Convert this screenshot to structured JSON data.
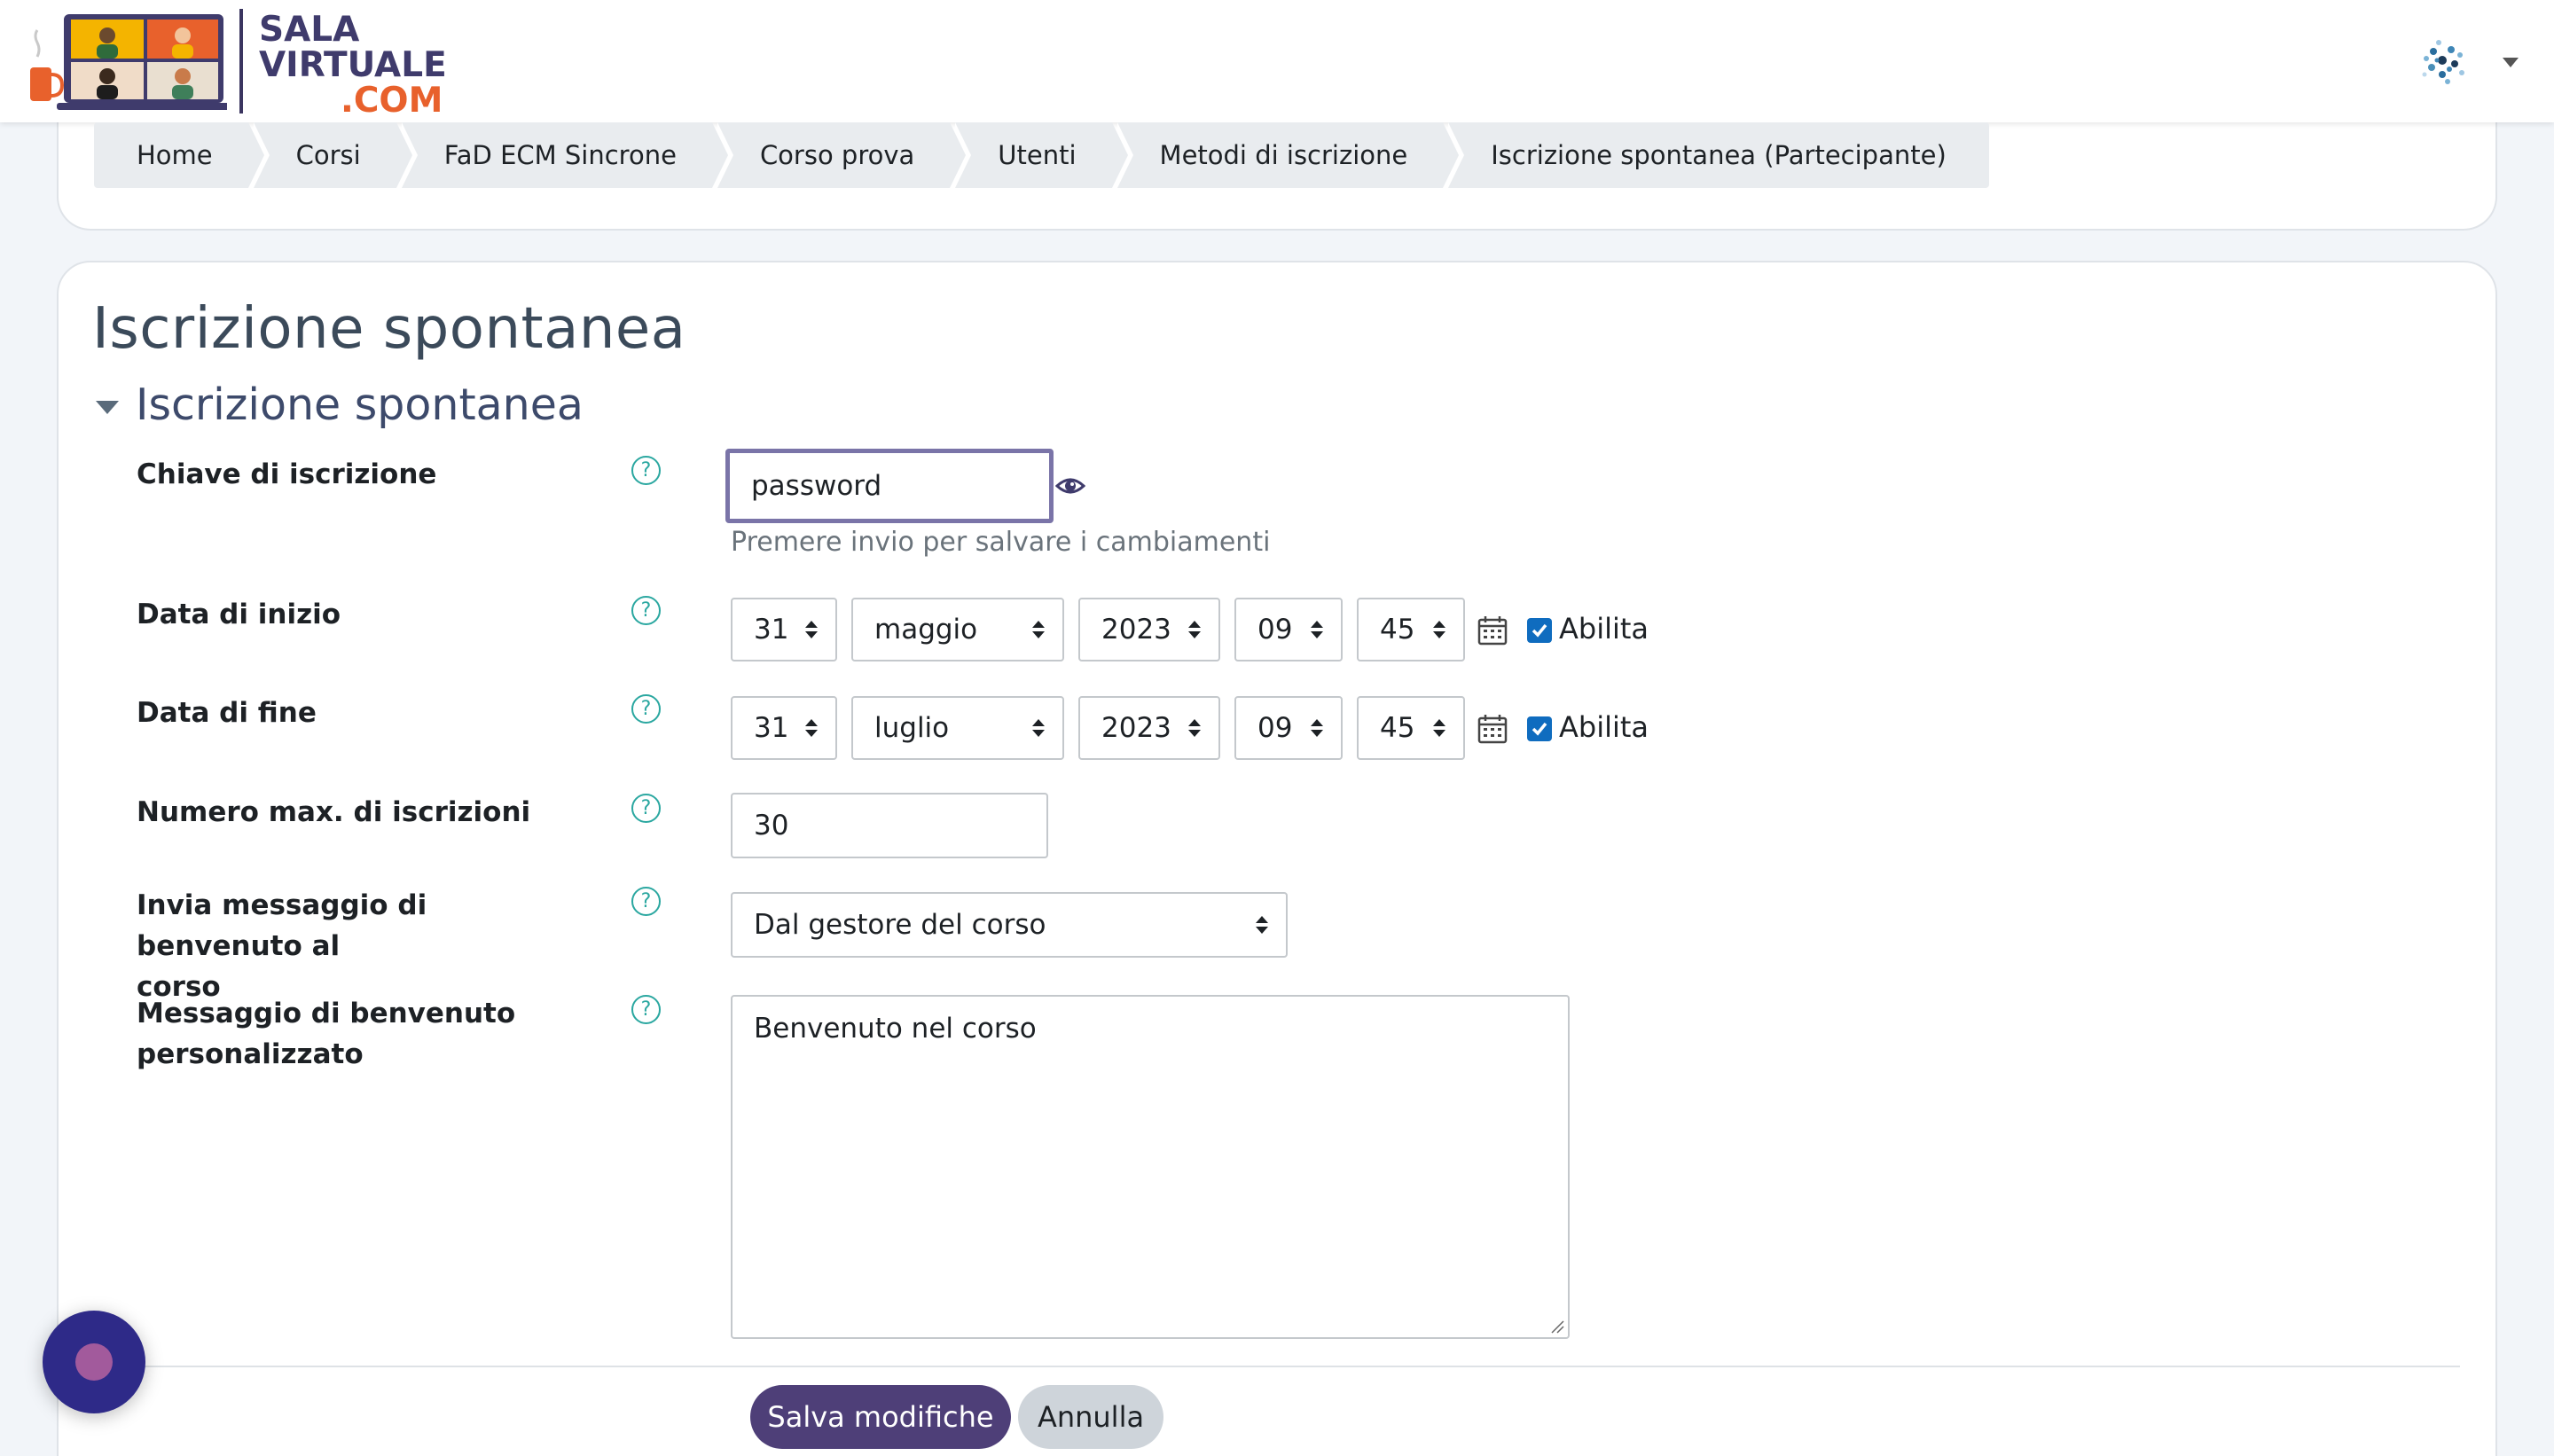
{
  "brand": {
    "line1": "SALA",
    "line2": "VIRTUALE",
    "line3": ".COM",
    "primary_color": "#3f3b6c",
    "accent_color": "#e8612c"
  },
  "breadcrumb": [
    "Home",
    "Corsi",
    "FaD ECM Sincrone",
    "Corso prova",
    "Utenti",
    "Metodi di iscrizione",
    "Iscrizione spontanea (Partecipante)"
  ],
  "page": {
    "title": "Iscrizione spontanea",
    "section_title": "Iscrizione spontanea"
  },
  "form": {
    "enrol_key": {
      "label": "Chiave di iscrizione",
      "value": "password",
      "hint": "Premere invio per salvare i cambiamenti",
      "reveal_icon": "eye-icon"
    },
    "start_date": {
      "label": "Data di inizio",
      "day": "31",
      "month": "maggio",
      "year": "2023",
      "hour": "09",
      "minute": "45",
      "enable_label": "Abilita",
      "enabled": true
    },
    "end_date": {
      "label": "Data di fine",
      "day": "31",
      "month": "luglio",
      "year": "2023",
      "hour": "09",
      "minute": "45",
      "enable_label": "Abilita",
      "enabled": true
    },
    "max_enrolled": {
      "label": "Numero max. di iscrizioni",
      "value": "30"
    },
    "welcome_message": {
      "label_line1": "Invia messaggio di benvenuto al",
      "label_line2": "corso",
      "value": "Dal gestore del corso"
    },
    "custom_welcome": {
      "label_line1": "Messaggio di benvenuto",
      "label_line2": "personalizzato",
      "value": "Benvenuto nel corso"
    },
    "help_glyph": "?"
  },
  "actions": {
    "save": "Salva modifiche",
    "cancel": "Annulla",
    "primary_color": "#4e3f78"
  },
  "colors": {
    "page_bg": "#f2f5f9",
    "help_icon": "#2aa7a0",
    "checkbox": "#0f6cbf"
  }
}
